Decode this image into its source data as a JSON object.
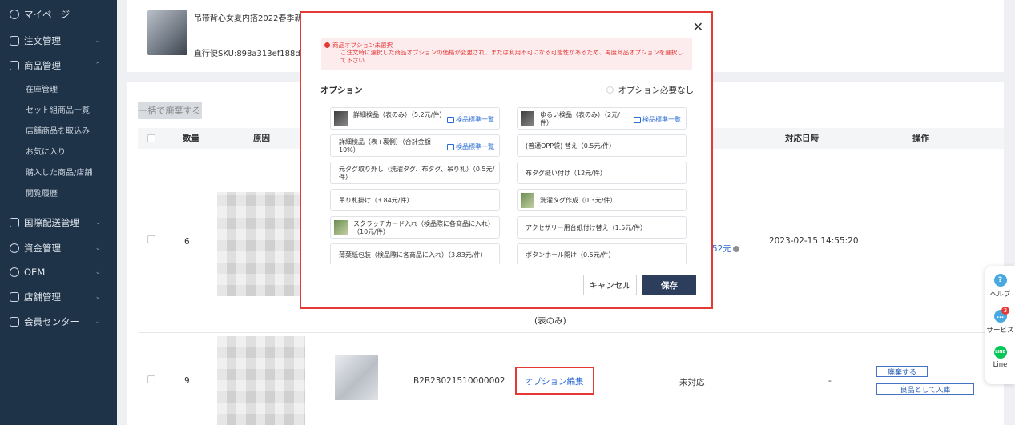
{
  "sidebar": {
    "items": [
      {
        "label": "マイページ"
      },
      {
        "label": "注文管理"
      },
      {
        "label": "商品管理"
      },
      {
        "label": "国際配送管理"
      },
      {
        "label": "資金管理"
      },
      {
        "label": "OEM"
      },
      {
        "label": "店舗管理"
      },
      {
        "label": "会員センター"
      }
    ],
    "sub_items": [
      {
        "label": "在庫管理"
      },
      {
        "label": "セット組商品一覧"
      },
      {
        "label": "店舗商品を取込み"
      },
      {
        "label": "お気に入り"
      },
      {
        "label": "購入した商品/店舗"
      },
      {
        "label": "閲覧履歴"
      }
    ]
  },
  "product": {
    "title": "吊带背心女夏内搭2022春季新款",
    "sku": "直行便SKU:898a313ef188db"
  },
  "list": {
    "bulk_button": "一括で廃棄する",
    "headers": {
      "qty": "数量",
      "reason": "原因",
      "date": "対応日時",
      "actions": "操作"
    },
    "rows": [
      {
        "qty": "6",
        "amount": "52元",
        "date": "2023-02-15 14:55:20"
      },
      {
        "qty": "9",
        "order_no": "B2B23021510000002",
        "option_edit": "オプション編集",
        "status": "未対応",
        "date": "-",
        "discard": "廃棄する",
        "stock_in": "良品として入庫"
      }
    ],
    "partial_text": "(表のみ)"
  },
  "modal": {
    "alert_title": "商品オプション未選択",
    "alert_body": "ご注文時に選択した商品オプションの価格が変更され、または利用不可になる可能性があるため、再度商品オプションを選択して下さい",
    "heading": "オプション",
    "no_option_label": "オプション必要なし",
    "options_left": [
      {
        "text": "詳細検品（表のみ）（5.2元/件）",
        "link": "検品標準一覧"
      },
      {
        "text": "詳細検品（表+裏側）（合計金額 10%）",
        "link": "検品標準一覧"
      },
      {
        "text": "元タグ取り外し（洗濯タグ、布タグ、吊り札）（0.5元/件）"
      },
      {
        "text": "吊り札掛け（3.84元/件）"
      },
      {
        "text": "スクラッチカード入れ（検品際に各商品に入れ）（10元/件）"
      },
      {
        "text": "薄葉紙包装（検品際に各商品に入れ）（3.83元/件）"
      }
    ],
    "options_right": [
      {
        "text": "ゆるい検品（表のみ）（2元/件）",
        "link": "検品標準一覧"
      },
      {
        "text": "(普通OPP袋) 替え（0.5元/件）"
      },
      {
        "text": "布タグ縫い付け（12元/件）"
      },
      {
        "text": "洗濯タグ作成（0.3元/件）"
      },
      {
        "text": "アクセサリー用台紙付け替え（1.5元/件）"
      },
      {
        "text": "ボタンホール開け（0.5元/件）"
      }
    ],
    "cancel": "キャンセル",
    "save": "保存"
  },
  "float_panel": {
    "help": "ヘルプ",
    "service": "サービス",
    "service_badge": "3",
    "line": "Line",
    "line_icon_text": "LINE"
  },
  "colors": {
    "sidebar_bg": "#1e3248",
    "accent_red": "#e53935",
    "save_button": "#2c3e5c",
    "link_blue": "#2b6cd4"
  }
}
